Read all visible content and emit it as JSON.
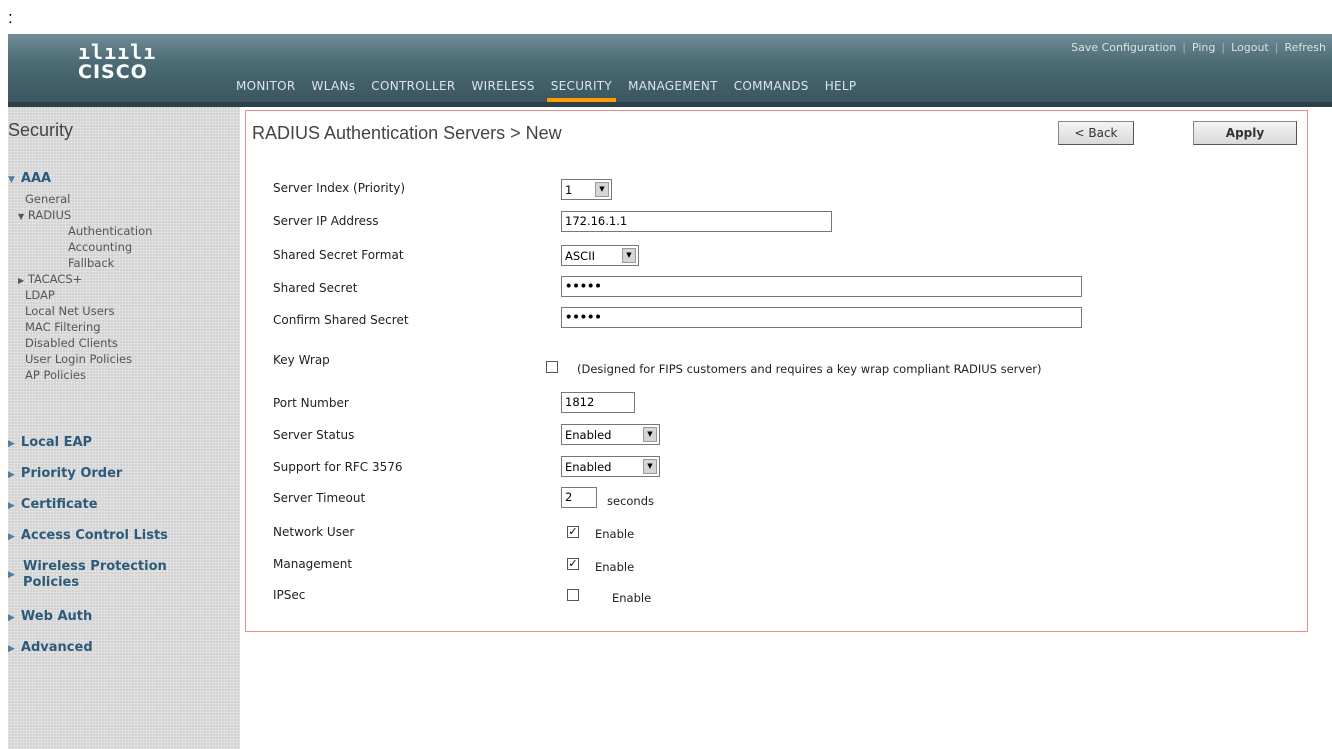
{
  "page_prefix": ":",
  "logo": {
    "bars": "ılıılı",
    "text": "cisco"
  },
  "top_links": [
    "Save Configuration",
    "Ping",
    "Logout",
    "Refresh"
  ],
  "nav": {
    "items": [
      "MONITOR",
      "WLANs",
      "CONTROLLER",
      "WIRELESS",
      "SECURITY",
      "MANAGEMENT",
      "COMMANDS",
      "HELP"
    ],
    "active": "SECURITY"
  },
  "sidebar": {
    "title": "Security",
    "aaa": {
      "label": "AAA",
      "general": "General",
      "radius": "RADIUS",
      "authentication": "Authentication",
      "accounting": "Accounting",
      "fallback": "Fallback",
      "tacacs": "TACACS+",
      "ldap": "LDAP",
      "local_net_users": "Local Net Users",
      "mac_filtering": "MAC Filtering",
      "disabled_clients": "Disabled Clients",
      "user_login_policies": "User Login Policies",
      "ap_policies": "AP Policies"
    },
    "groups": {
      "local_eap": "Local EAP",
      "priority_order": "Priority Order",
      "certificate": "Certificate",
      "acl": "Access Control Lists",
      "wpp_line1": "Wireless Protection",
      "wpp_line2": "Policies",
      "web_auth": "Web Auth",
      "advanced": "Advanced"
    }
  },
  "panel": {
    "title": "RADIUS Authentication Servers > New",
    "back_button": "< Back",
    "apply_button": "Apply"
  },
  "form": {
    "server_index": {
      "label": "Server Index (Priority)",
      "value": "1"
    },
    "server_ip": {
      "label": "Server IP Address",
      "value": "172.16.1.1"
    },
    "secret_format": {
      "label": "Shared Secret Format",
      "value": "ASCII"
    },
    "shared_secret": {
      "label": "Shared Secret",
      "value": "•••••"
    },
    "confirm_secret": {
      "label": "Confirm Shared Secret",
      "value": "•••••"
    },
    "key_wrap": {
      "label": "Key Wrap",
      "checked": false,
      "note": "(Designed for FIPS customers and requires a key wrap compliant RADIUS server)"
    },
    "port_number": {
      "label": "Port Number",
      "value": "1812"
    },
    "server_status": {
      "label": "Server Status",
      "value": "Enabled"
    },
    "rfc3576": {
      "label": "Support for RFC 3576",
      "value": "Enabled"
    },
    "server_timeout": {
      "label": "Server Timeout",
      "value": "2",
      "unit": "seconds"
    },
    "network_user": {
      "label": "Network User",
      "checked": true,
      "option": "Enable"
    },
    "management": {
      "label": "Management",
      "checked": true,
      "option": "Enable"
    },
    "ipsec": {
      "label": "IPSec",
      "checked": false,
      "option": "Enable"
    }
  },
  "colors": {
    "header": "#4d6c76",
    "active_tab_underline": "#ff9a00",
    "sidebar_bg": "#d3d3d3",
    "sidebar_group": "#2c5a7a",
    "panel_border": "#ee8c8c"
  }
}
